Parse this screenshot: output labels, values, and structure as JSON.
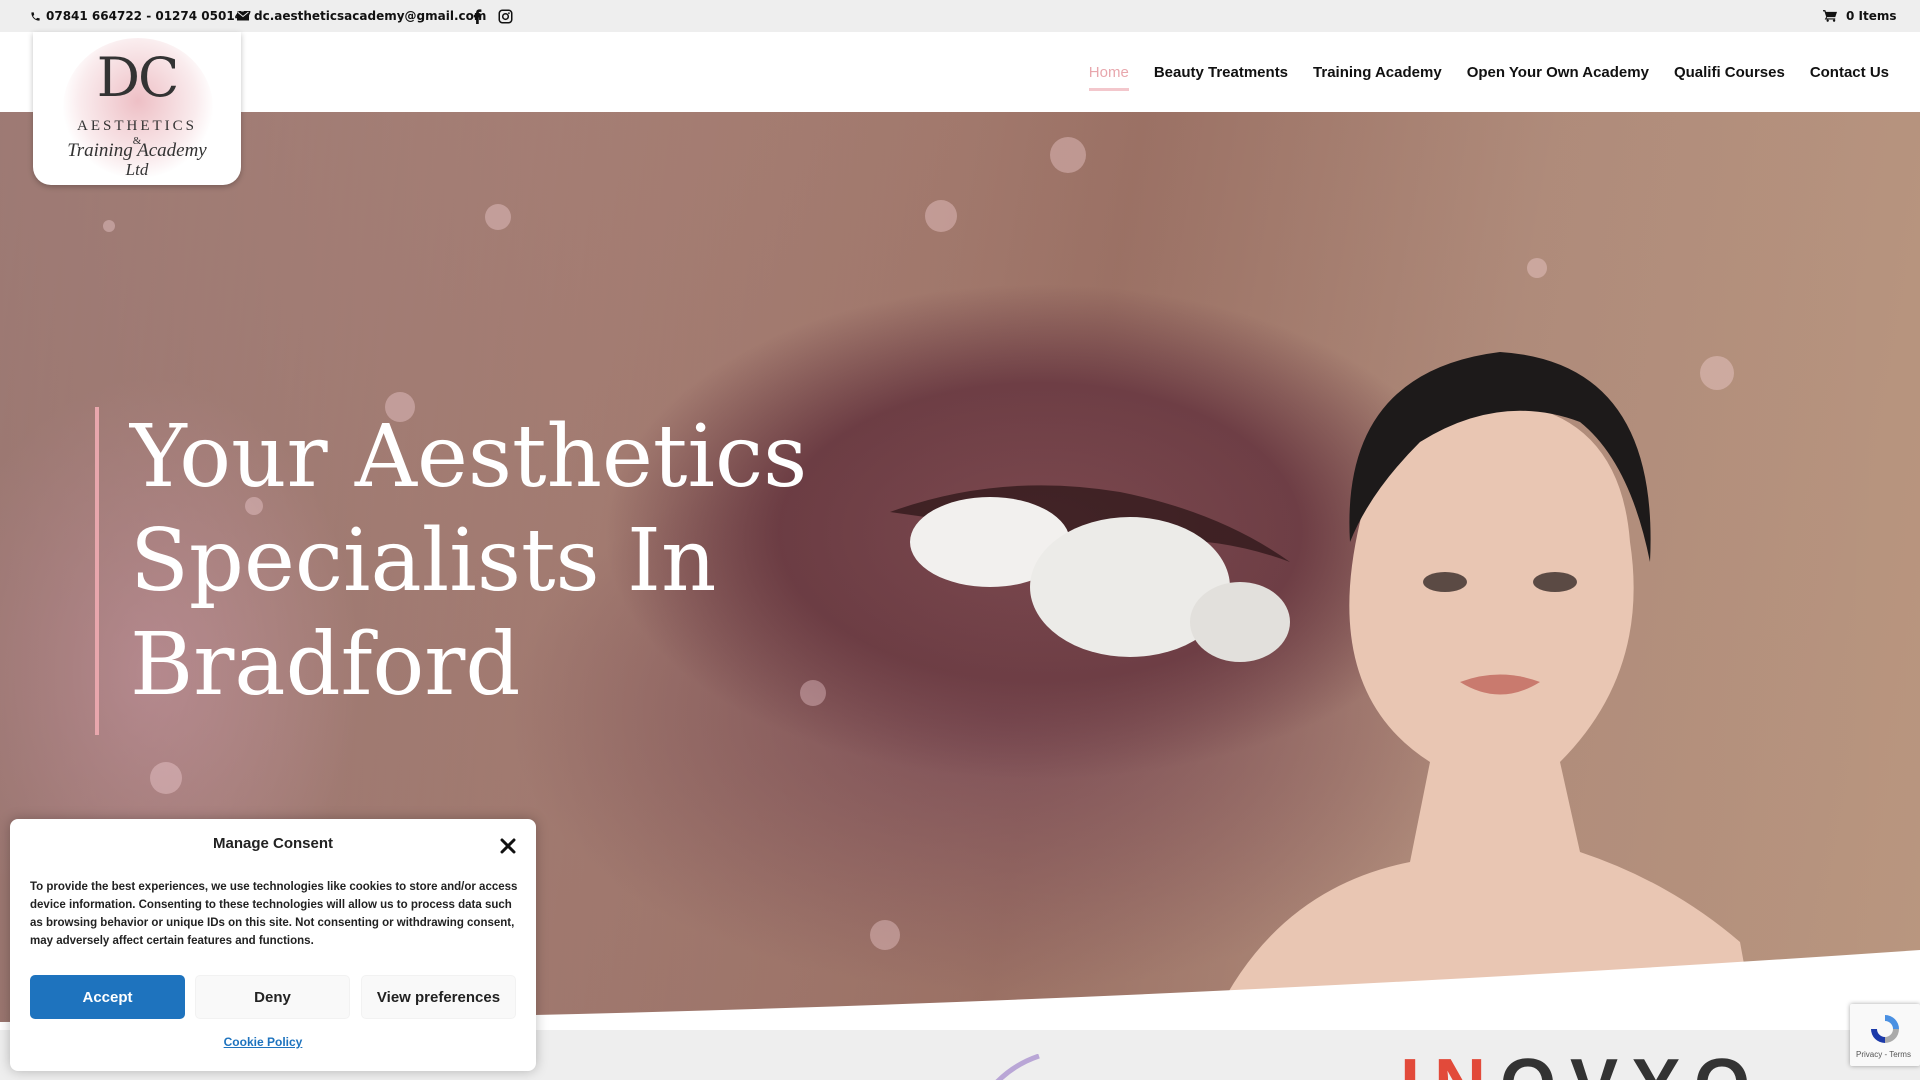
{
  "topbar": {
    "phone": "07841 664722 - 01274 050147",
    "email": "dc.aestheticsacademy@gmail.com",
    "cart": "0 Items",
    "icons": [
      "phone-icon",
      "mail-icon",
      "facebook-icon",
      "instagram-icon",
      "cart-icon"
    ]
  },
  "logo": {
    "monogram": "DC",
    "line1": "AESTHETICS",
    "line2": "&",
    "line3": "Training Academy",
    "line4": "Ltd"
  },
  "nav": {
    "items": [
      {
        "label": "Home",
        "active": true
      },
      {
        "label": "Beauty Treatments",
        "active": false
      },
      {
        "label": "Training Academy",
        "active": false
      },
      {
        "label": "Open Your Own Academy",
        "active": false
      },
      {
        "label": "Qualifi Courses",
        "active": false
      },
      {
        "label": "Contact Us",
        "active": false
      }
    ]
  },
  "hero": {
    "title_line1": "Your Aesthetics",
    "title_line2": "Specialists In",
    "title_line3": "Bradford"
  },
  "consent": {
    "title": "Manage Consent",
    "message": "To provide the best experiences, we use technologies like cookies to store and/or access device information. Consenting to these technologies will allow us to process data such as browsing behavior or unique IDs on this site. Not consenting or withdrawing consent, may adversely affect certain features and functions.",
    "accept": "Accept",
    "deny": "Deny",
    "preferences": "View preferences",
    "policy": "Cookie Policy"
  },
  "recaptcha": {
    "links": "Privacy - Terms"
  },
  "colors": {
    "accent_pink": "#e8a7ad",
    "accept_blue": "#1e73be",
    "topbar_bg": "#eeeeee"
  }
}
